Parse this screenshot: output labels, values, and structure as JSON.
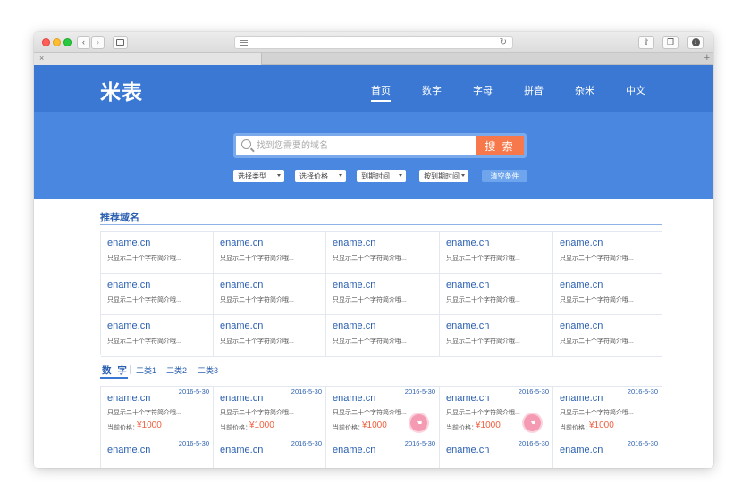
{
  "site": {
    "logo": "米表"
  },
  "nav": [
    {
      "label": "首页",
      "active": true
    },
    {
      "label": "数字"
    },
    {
      "label": "字母"
    },
    {
      "label": "拼音"
    },
    {
      "label": "杂米"
    },
    {
      "label": "中文"
    }
  ],
  "search": {
    "placeholder": "找到您需要的域名",
    "button": "搜 索"
  },
  "filters": [
    "选择类型",
    "选择价格",
    "到期时间",
    "按到期时间"
  ],
  "clear_label": "清空条件",
  "recommended": {
    "title": "推荐域名",
    "items": [
      {
        "domain": "ename.cn",
        "desc": "只显示二十个字符简介哦..."
      },
      {
        "domain": "ename.cn",
        "desc": "只显示二十个字符简介哦..."
      },
      {
        "domain": "ename.cn",
        "desc": "只显示二十个字符简介哦..."
      },
      {
        "domain": "ename.cn",
        "desc": "只显示二十个字符简介哦..."
      },
      {
        "domain": "ename.cn",
        "desc": "只显示二十个字符简介哦..."
      },
      {
        "domain": "ename.cn",
        "desc": "只显示二十个字符简介哦..."
      },
      {
        "domain": "ename.cn",
        "desc": "只显示二十个字符简介哦..."
      },
      {
        "domain": "ename.cn",
        "desc": "只显示二十个字符简介哦..."
      },
      {
        "domain": "ename.cn",
        "desc": "只显示二十个字符简介哦..."
      },
      {
        "domain": "ename.cn",
        "desc": "只显示二十个字符简介哦..."
      },
      {
        "domain": "ename.cn",
        "desc": "只显示二十个字符简介哦..."
      },
      {
        "domain": "ename.cn",
        "desc": "只显示二十个字符简介哦..."
      },
      {
        "domain": "ename.cn",
        "desc": "只显示二十个字符简介哦..."
      },
      {
        "domain": "ename.cn",
        "desc": "只显示二十个字符简介哦..."
      },
      {
        "domain": "ename.cn",
        "desc": "只显示二十个字符简介哦..."
      }
    ]
  },
  "category_tabs": [
    {
      "label": "数 字",
      "active": true
    },
    {
      "label": "二类1"
    },
    {
      "label": "二类2"
    },
    {
      "label": "二类3"
    }
  ],
  "listing": {
    "price_label": "当前价格：",
    "items": [
      {
        "domain": "ename.cn",
        "date": "2016-5-30",
        "desc": "只显示二十个字符简介哦...",
        "price": "¥1000",
        "badge": false
      },
      {
        "domain": "ename.cn",
        "date": "2016-5-30",
        "desc": "只显示二十个字符简介哦...",
        "price": "¥1000",
        "badge": false
      },
      {
        "domain": "ename.cn",
        "date": "2016-5-30",
        "desc": "只显示二十个字符简介哦...",
        "price": "¥1000",
        "badge": true
      },
      {
        "domain": "ename.cn",
        "date": "2016-5-30",
        "desc": "只显示二十个字符简介哦...",
        "price": "¥1000",
        "badge": true
      },
      {
        "domain": "ename.cn",
        "date": "2016-5-30",
        "desc": "只显示二十个字符简介哦...",
        "price": "¥1000",
        "badge": false
      },
      {
        "domain": "ename.cn",
        "date": "2016-5-30",
        "desc": "",
        "price": "",
        "badge": false
      },
      {
        "domain": "ename.cn",
        "date": "2016-5-30",
        "desc": "",
        "price": "",
        "badge": false
      },
      {
        "domain": "ename.cn",
        "date": "2016-5-30",
        "desc": "",
        "price": "",
        "badge": false
      },
      {
        "domain": "ename.cn",
        "date": "2016-5-30",
        "desc": "",
        "price": "",
        "badge": false
      },
      {
        "domain": "ename.cn",
        "date": "2016-5-30",
        "desc": "",
        "price": "",
        "badge": false
      }
    ]
  },
  "colors": {
    "header": "#3a78d4",
    "search_band": "#4a87e0",
    "search_button": "#f7784a",
    "link": "#2a5fb0",
    "price": "#f06040"
  }
}
